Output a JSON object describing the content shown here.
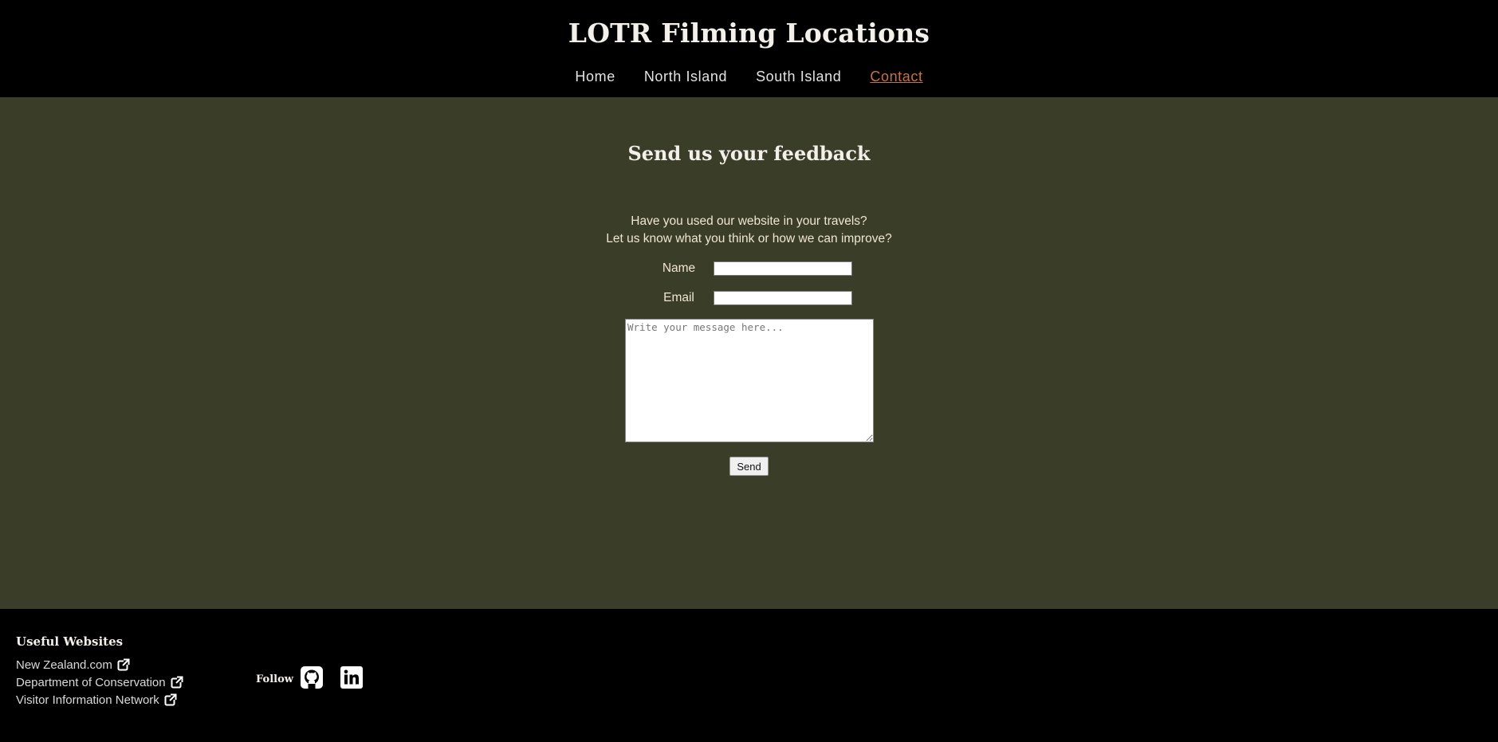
{
  "header": {
    "title": "LOTR Filming Locations",
    "nav": [
      {
        "label": "Home"
      },
      {
        "label": "North Island"
      },
      {
        "label": "South Island"
      },
      {
        "label": "Contact",
        "active": true
      }
    ]
  },
  "main": {
    "heading": "Send us your feedback",
    "intro_line1": "Have you used our website in your travels?",
    "intro_line2": "Let us know what you think or how we can improve?",
    "form": {
      "name_label": "Name",
      "name_value": "",
      "email_label": "Email",
      "email_value": "",
      "message_placeholder": "Write your message here...",
      "send_label": "Send"
    }
  },
  "footer": {
    "useful_heading": "Useful Websites",
    "links": [
      {
        "label": "New Zealand.com",
        "icon": "external-link-icon"
      },
      {
        "label": "Department of Conservation",
        "icon": "external-link-icon"
      },
      {
        "label": "Visitor Information Network",
        "icon": "external-link-icon"
      }
    ],
    "follow_label": "Follow",
    "social": [
      {
        "icon": "github-icon"
      },
      {
        "icon": "linkedin-icon"
      }
    ]
  },
  "colors": {
    "header_bg": "#000000",
    "main_bg": "#3a3e29",
    "active_link": "#c8733a",
    "footer_bg": "#000000"
  }
}
